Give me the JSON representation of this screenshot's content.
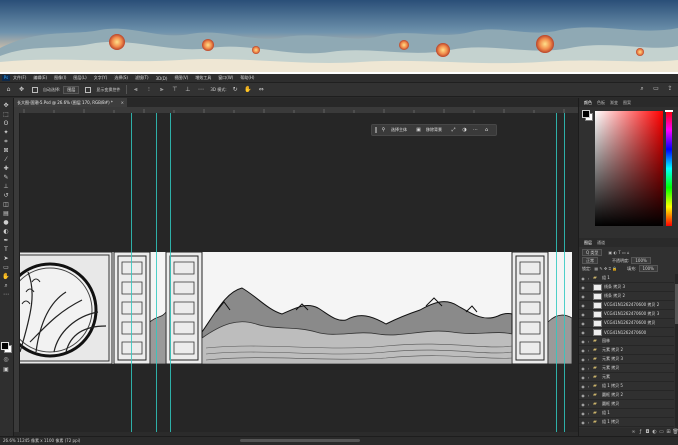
{
  "menu": {
    "app_icon": "Ps",
    "items": [
      "文件(F)",
      "编辑(E)",
      "图像(I)",
      "图层(L)",
      "文字(Y)",
      "选择(S)",
      "滤镜(T)",
      "3D(D)",
      "视图(V)",
      "增效工具",
      "窗口(W)",
      "帮助(H)"
    ]
  },
  "options": {
    "home_icon": "home-icon",
    "tool_icon": "move-icon",
    "auto_select_label": "自动选择:",
    "auto_select_value": "图层",
    "transform_label": "显示变换控件",
    "more_icon": "ellipsis-icon",
    "mode_label": "3D 模式:"
  },
  "document": {
    "tab_title": "长大图-国潮-5.Psd @ 26.6% (图层 170, RGB/8#) *",
    "close": "×"
  },
  "context_bar": {
    "select_subject": "选择主体",
    "remove_bg": "移除背景"
  },
  "status": {
    "text": "26.6%    11245 像素 x 1100 像素 (72 ppi)"
  },
  "panel": {
    "tabs": [
      "颜色",
      "色板",
      "渐变",
      "图案"
    ],
    "active_tab": 0,
    "colors": {
      "foreground": "#000000",
      "background": "#ffffff",
      "hue_top": "#ff0000"
    }
  },
  "layers_panel": {
    "tabs": [
      "图层",
      "通道"
    ],
    "active_tab": 0,
    "filter_label": "Q 类型",
    "blend_mode": "正常",
    "opacity_label": "不透明度:",
    "opacity": "100%",
    "lock_label": "锁定:",
    "fill_label": "填充:",
    "fill": "100%",
    "layers": [
      {
        "name": "组 1",
        "type": "folder",
        "eye": true
      },
      {
        "name": "线条 拷贝 3",
        "type": "layer",
        "eye": true
      },
      {
        "name": "线条 拷贝 2",
        "type": "layer",
        "eye": true
      },
      {
        "name": "VCG41N1262470600 拷贝 2",
        "type": "layer",
        "eye": true
      },
      {
        "name": "VCG41N1262470600 拷贝 3",
        "type": "layer",
        "eye": true
      },
      {
        "name": "VCG41N1262470600 拷贝",
        "type": "layer",
        "eye": true
      },
      {
        "name": "VCG41N1262470600",
        "type": "layer",
        "eye": true
      },
      {
        "name": "园林",
        "type": "folder",
        "eye": true
      },
      {
        "name": "元素 拷贝 2",
        "type": "folder",
        "eye": true
      },
      {
        "name": "元素 拷贝 3",
        "type": "folder",
        "eye": true
      },
      {
        "name": "元素 拷贝",
        "type": "folder",
        "eye": true
      },
      {
        "name": "元素",
        "type": "folder",
        "eye": true
      },
      {
        "name": "组 1 拷贝 5",
        "type": "folder",
        "eye": true
      },
      {
        "name": "圆框 拷贝 2",
        "type": "folder",
        "eye": true
      },
      {
        "name": "圆框 拷贝",
        "type": "folder",
        "eye": true
      },
      {
        "name": "组 1",
        "type": "folder",
        "eye": true
      },
      {
        "name": "组 1 拷贝",
        "type": "folder",
        "eye": true
      },
      {
        "name": "组 1 拷贝 6",
        "type": "folder",
        "eye": true
      },
      {
        "name": "图层",
        "type": "folder",
        "eye": true
      }
    ]
  }
}
